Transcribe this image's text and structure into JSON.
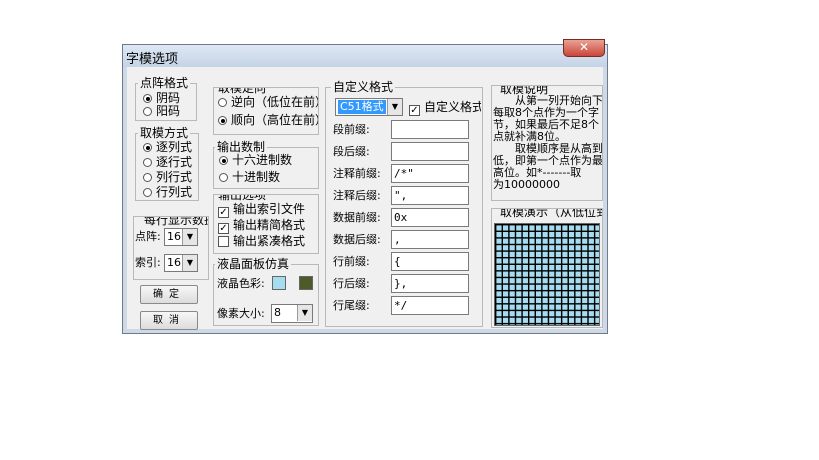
{
  "window": {
    "title": "字模选项",
    "close_glyph": "✕"
  },
  "dot_format": {
    "label": "点阵格式",
    "options": [
      {
        "label": "阴码",
        "selected": true
      },
      {
        "label": "阳码",
        "selected": false
      }
    ]
  },
  "scan_mode": {
    "label": "取模方式",
    "options": [
      {
        "label": "逐列式",
        "selected": true
      },
      {
        "label": "逐行式",
        "selected": false
      },
      {
        "label": "列行式",
        "selected": false
      },
      {
        "label": "行列式",
        "selected": false
      }
    ]
  },
  "per_row": {
    "label": "每行显示数据",
    "dots_label": "点阵:",
    "dots_value": "16",
    "index_label": "索引:",
    "index_value": "16"
  },
  "buttons": {
    "ok": "确定",
    "cancel": "取消"
  },
  "direction": {
    "label": "取模走向",
    "options": [
      {
        "label": "逆向（低位在前）",
        "selected": false
      },
      {
        "label": "顺向（高位在前）",
        "selected": true
      }
    ]
  },
  "numbase": {
    "label": "输出数制",
    "options": [
      {
        "label": "十六进制数",
        "selected": true
      },
      {
        "label": "十进制数",
        "selected": false
      }
    ]
  },
  "output_opts": {
    "label": "输出选项",
    "items": [
      {
        "label": "输出索引文件",
        "checked": true
      },
      {
        "label": "输出精简格式",
        "checked": true
      },
      {
        "label": "输出紧凑格式",
        "checked": false
      }
    ]
  },
  "lcd": {
    "label": "液晶面板仿真",
    "color_label": "液晶色彩:",
    "pixel_label": "像素大小:",
    "pixel_value": "8",
    "color_light": "#a6dcef",
    "color_dark": "#4d5a2a"
  },
  "custom": {
    "label": "自定义格式",
    "format_value": "C51格式",
    "custom_check_label": "自定义格式",
    "fields": [
      {
        "label": "段前缀:",
        "value": ""
      },
      {
        "label": "段后缀:",
        "value": ""
      },
      {
        "label": "注释前缀:",
        "value": "/*\""
      },
      {
        "label": "注释后缀:",
        "value": "\","
      },
      {
        "label": "数据前缀:",
        "value": "0x"
      },
      {
        "label": "数据后缀:",
        "value": ","
      },
      {
        "label": "行前缀:",
        "value": "{"
      },
      {
        "label": "行后缀:",
        "value": "},"
      },
      {
        "label": "行尾缀:",
        "value": "*/"
      }
    ]
  },
  "explain": {
    "label": "取模说明",
    "text": "　　从第一列开始向下\n每取8个点作为一个字\n节，如果最后不足8个\n点就补满8位。\n　　取模顺序是从高到\n低，即第一个点作为最\n高位。如*-------取\n为10000000"
  },
  "demo": {
    "label": "取模演示（从低位到高位）",
    "grid_color": "#a6dcef",
    "line_color": "#000000"
  }
}
